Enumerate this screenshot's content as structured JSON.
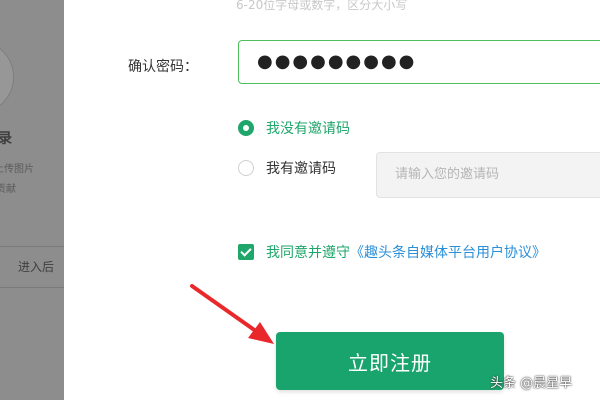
{
  "background": {
    "title": "录",
    "line1": "上传图片",
    "line2": "贡献",
    "button": "进入后"
  },
  "form": {
    "password_hint": "6-20位字母或数字，区分大小写",
    "confirm_label": "确认密码：",
    "confirm_value": "●●●●●●●●●",
    "no_invite_label": "我没有邀请码",
    "has_invite_label": "我有邀请码",
    "invite_placeholder": "请输入您的邀请码",
    "agree_text": "我同意并遵守",
    "agreement_link": "《趣头条自媒体平台用户协议》",
    "register_button": "立即注册"
  },
  "watermark": "头条 @晨星早",
  "colors": {
    "accent_green": "#1fa66a",
    "link_blue": "#2b8fd8",
    "arrow_red": "#e8282a"
  }
}
